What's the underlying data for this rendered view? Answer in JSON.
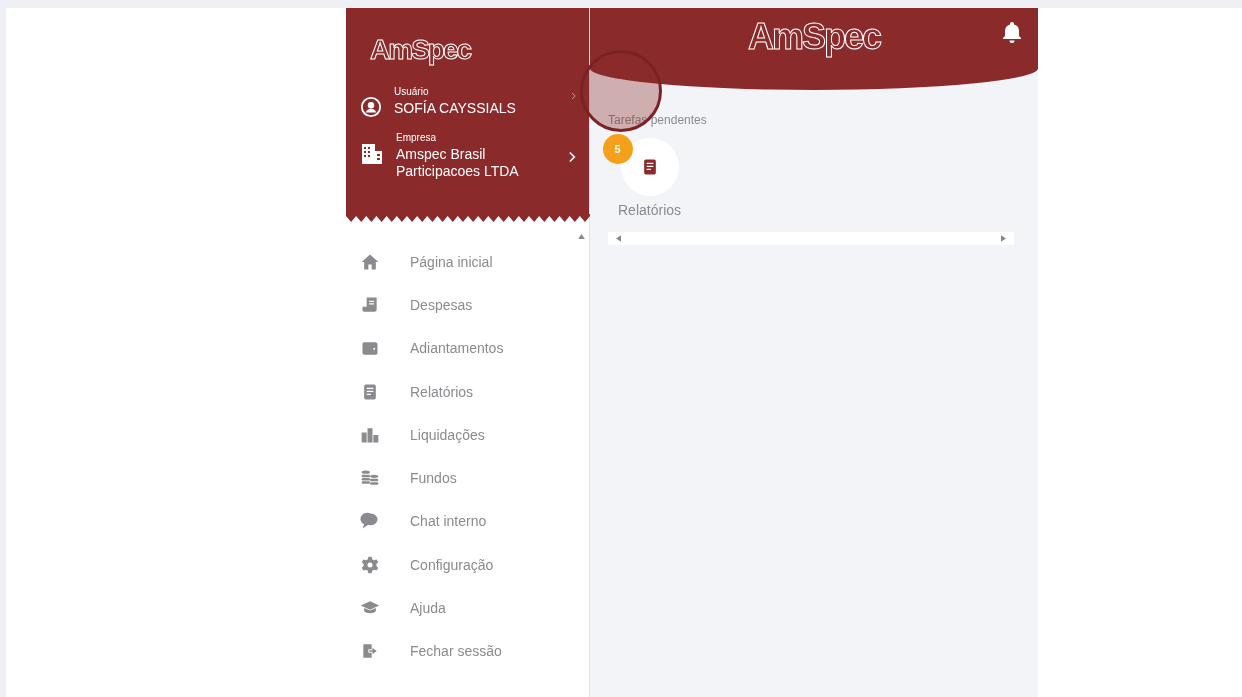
{
  "sidebar": {
    "logo": "**Am**Spec",
    "user": {
      "label": "Usuário",
      "name": "SOFÍA CAYSSIALS"
    },
    "company": {
      "label": "Empresa",
      "name": "Amspec Brasil Participacoes LTDA"
    },
    "items": [
      {
        "kind": "home",
        "label": "Página inicial"
      },
      {
        "kind": "expenses",
        "label": "Despesas"
      },
      {
        "kind": "wallet",
        "label": "Adiantamentos"
      },
      {
        "kind": "report",
        "label": "Relatórios"
      },
      {
        "kind": "chart",
        "label": "Liquidações"
      },
      {
        "kind": "coins",
        "label": "Fundos"
      },
      {
        "kind": "chat",
        "label": "Chat interno"
      },
      {
        "kind": "gear",
        "label": "Configuração"
      },
      {
        "kind": "cap",
        "label": "Ajuda"
      },
      {
        "kind": "logout",
        "label": "Fechar sessão"
      }
    ]
  },
  "header": {
    "logo": "**Am**Spec"
  },
  "tasks": {
    "title": "Tarefas pendentes",
    "items": [
      {
        "label": "Relatórios",
        "count": "5"
      }
    ]
  }
}
